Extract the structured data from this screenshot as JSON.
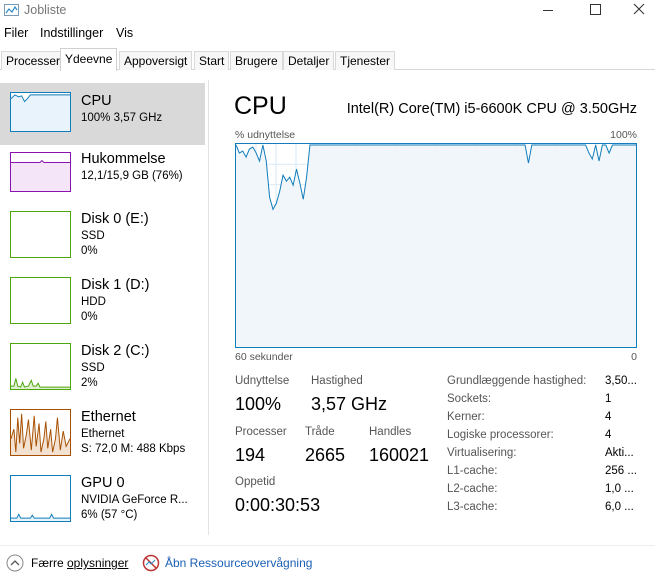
{
  "window": {
    "title": "Jobliste"
  },
  "menu": {
    "items": [
      "Filer",
      "Indstillinger",
      "Vis"
    ]
  },
  "tabs": [
    "Processer",
    "Ydeevne",
    "Appoversigt",
    "Start",
    "Brugere",
    "Detaljer",
    "Tjenester"
  ],
  "active_tab": "Ydeevne",
  "sidebar": {
    "items": [
      {
        "title": "CPU",
        "line1": "100% 3,57 GHz",
        "line2": "",
        "line3": ""
      },
      {
        "title": "Hukommelse",
        "line1": "12,1/15,9 GB (76%)",
        "line2": "",
        "line3": ""
      },
      {
        "title": "Disk 0 (E:)",
        "line1": "SSD",
        "line2": "0%",
        "line3": ""
      },
      {
        "title": "Disk 1 (D:)",
        "line1": "HDD",
        "line2": "0%",
        "line3": ""
      },
      {
        "title": "Disk 2 (C:)",
        "line1": "SSD",
        "line2": "2%",
        "line3": ""
      },
      {
        "title": "Ethernet",
        "line1": "Ethernet",
        "line2": "S: 72,0  M: 488 Kbps",
        "line3": ""
      },
      {
        "title": "GPU 0",
        "line1": "NVIDIA GeForce R...",
        "line2": "6% (57 °C)",
        "line3": ""
      }
    ]
  },
  "main": {
    "title": "CPU",
    "model": "Intel(R) Core(TM) i5-6600K CPU @ 3.50GHz",
    "graph": {
      "top_left": "% udnyttelse",
      "top_right": "100%",
      "bottom_left": "60 sekunder",
      "bottom_right": "0"
    },
    "stats": {
      "utilization_label": "Udnyttelse",
      "utilization_value": "100%",
      "speed_label": "Hastighed",
      "speed_value": "3,57 GHz",
      "processes_label": "Processer",
      "processes_value": "194",
      "threads_label": "Tråde",
      "threads_value": "2665",
      "handles_label": "Handles",
      "handles_value": "160021",
      "uptime_label": "Oppetid",
      "uptime_value": "0:00:30:53"
    },
    "info": [
      {
        "label": "Grundlæggende hastighed:",
        "value": "3,50..."
      },
      {
        "label": "Sockets:",
        "value": "1"
      },
      {
        "label": "Kerner:",
        "value": "4"
      },
      {
        "label": "Logiske processorer:",
        "value": "4"
      },
      {
        "label": "Virtualisering:",
        "value": "Akti..."
      },
      {
        "label": "L1-cache:",
        "value": "256 ..."
      },
      {
        "label": "L2-cache:",
        "value": "1,0 ..."
      },
      {
        "label": "L3-cache:",
        "value": "6,0 ..."
      }
    ]
  },
  "footer": {
    "fewer_details_prefix": "Færre ",
    "fewer_details_underlined": "oplysninger",
    "resource_monitor": "Åbn Ressourceovervågning"
  },
  "chart_data": {
    "type": "line",
    "series": [
      {
        "values": [
          100,
          96,
          97,
          94,
          98,
          99,
          96,
          92,
          100,
          92,
          74,
          68,
          71,
          77,
          85,
          82,
          84,
          80,
          88,
          81,
          73,
          84,
          100,
          100,
          100,
          100,
          100,
          100,
          100,
          100,
          100,
          100,
          100,
          100,
          100,
          100,
          100,
          100,
          100,
          100,
          100,
          100,
          100,
          100,
          100,
          100,
          100,
          100,
          100,
          100,
          100,
          100,
          100,
          100,
          100,
          100,
          100,
          100,
          100,
          100,
          100,
          100,
          100,
          100,
          100,
          100,
          100,
          100,
          100,
          100,
          100,
          100,
          100,
          100,
          100,
          100,
          100,
          100,
          100,
          100,
          100,
          100,
          100,
          100,
          100,
          100,
          100,
          91,
          100,
          100,
          100,
          100,
          100,
          100,
          100,
          100,
          100,
          100,
          100,
          100,
          100,
          100,
          100,
          100,
          100,
          96,
          93,
          100,
          92,
          100,
          100,
          96,
          100,
          100,
          100,
          100,
          100,
          100,
          100,
          100
        ]
      }
    ],
    "x_range": [
      60,
      0
    ],
    "ylim": [
      0,
      100
    ],
    "grid": true
  },
  "colors": {
    "cpu": "#117dbb",
    "memory": "#8b12ae",
    "disk": "#4da60c",
    "ethernet": "#a74f01",
    "selection": "#d9d9d9"
  }
}
